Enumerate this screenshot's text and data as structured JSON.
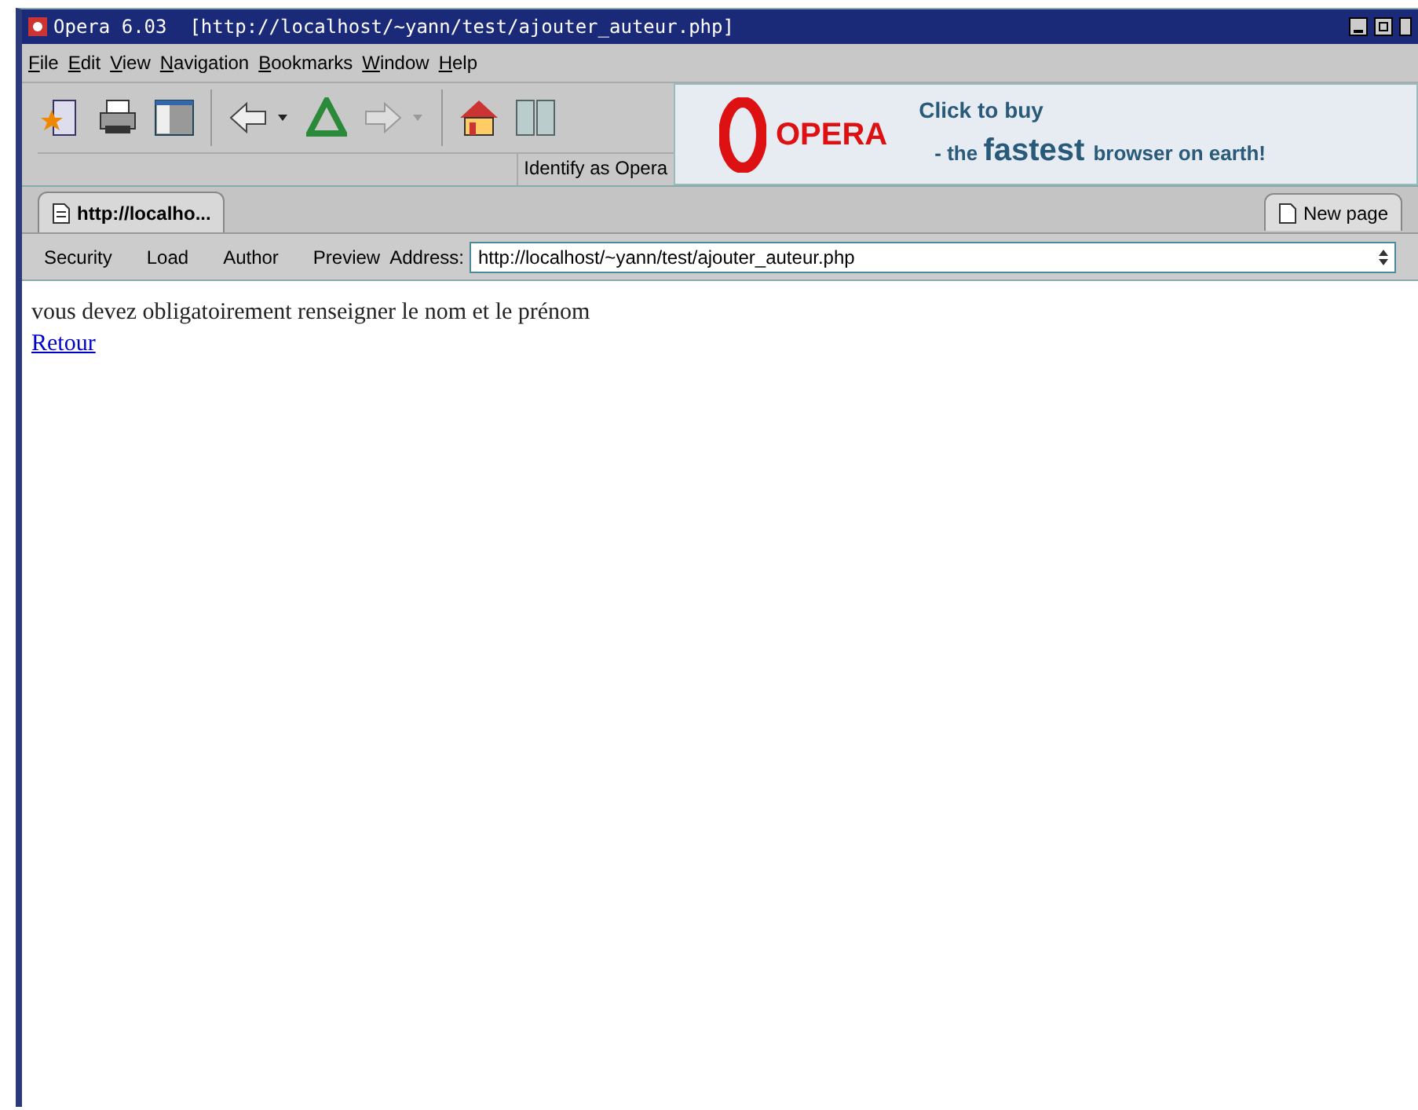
{
  "window": {
    "title": "Opera 6.03  [http://localhost/~yann/test/ajouter_auteur.php]"
  },
  "menu": [
    "File",
    "Edit",
    "View",
    "Navigation",
    "Bookmarks",
    "Window",
    "Help"
  ],
  "toolbar": {
    "identify": "Identify as Opera"
  },
  "banner": {
    "logo": "OPERA",
    "line_1": "Click to buy",
    "line_2_prefix": "- the",
    "line_2_emphasis": "fastest",
    "line_2_suffix": "browser on earth!"
  },
  "tabs": [
    {
      "label": "http://localho...",
      "selected": true
    }
  ],
  "new_page": "New page",
  "address_bar": {
    "buttons": [
      "Security",
      "Load",
      "Author",
      "Preview"
    ],
    "label": "Address:",
    "value": "http://localhost/~yann/test/ajouter_auteur.php"
  },
  "content": {
    "message": "vous devez obligatoirement renseigner le nom et le prénom",
    "link": "Retour"
  }
}
